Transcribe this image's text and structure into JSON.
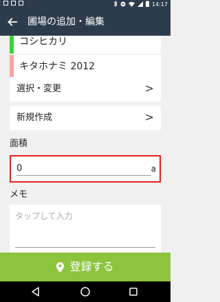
{
  "status_bar": {
    "time": "14:17",
    "left_icons": [
      "notification-icon",
      "notification-icon",
      "notification-icon"
    ],
    "right_icons": [
      "bluetooth-icon",
      "do-not-disturb-icon",
      "wifi-icon",
      "signal-icon",
      "battery-icon"
    ]
  },
  "app_bar": {
    "title": "圃場の追加・編集",
    "back_icon": "arrow-left-icon"
  },
  "crops": [
    {
      "name": "コシヒカリ",
      "color": "#3dd23d"
    },
    {
      "name": "キタホナミ 2012",
      "color": "#f5a3a3"
    }
  ],
  "nav": {
    "select_label": "選択・変更",
    "new_label": "新規作成",
    "chevron": ">"
  },
  "area": {
    "label": "面積",
    "value": "0",
    "unit": "a"
  },
  "memo": {
    "label": "メモ",
    "placeholder": "タップして入力"
  },
  "register": {
    "label": "登録する",
    "icon": "location-pin-icon"
  },
  "system_nav": [
    "back-triangle-icon",
    "home-circle-icon",
    "recents-square-icon"
  ],
  "colors": {
    "app_bar": "#2d3c4c",
    "accent_green": "#8cc43e",
    "highlight_red": "#e0201e",
    "background": "#f0f0f0"
  }
}
